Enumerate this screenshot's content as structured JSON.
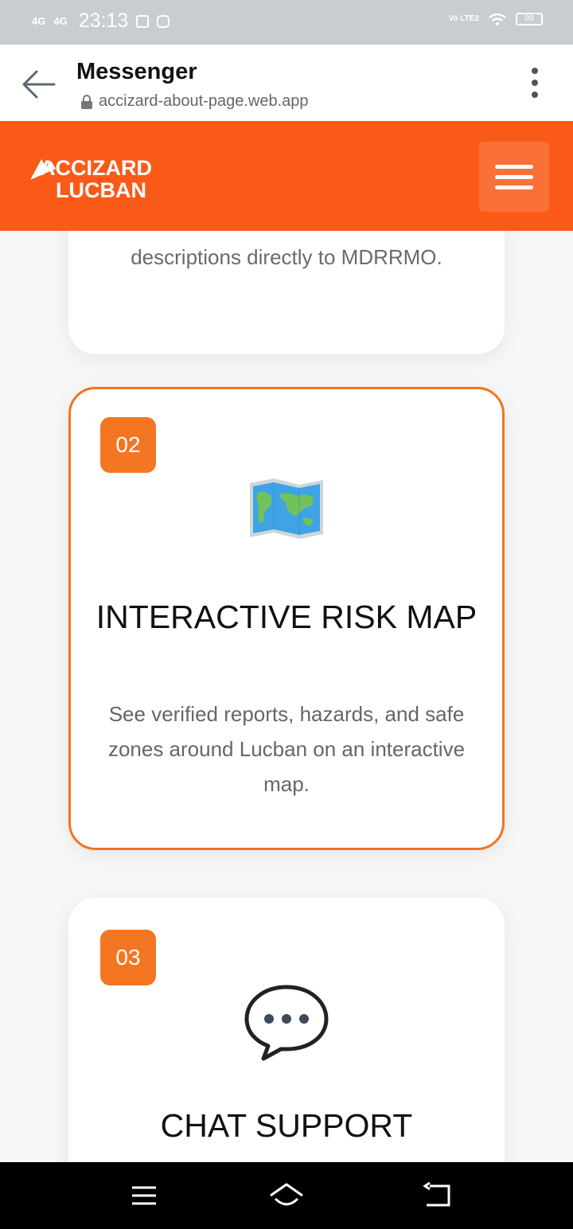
{
  "status_bar": {
    "network1": "4G",
    "network2": "4G",
    "time": "23:13",
    "volte": "Vo LTE2",
    "battery": "89"
  },
  "browser": {
    "title": "Messenger",
    "url": "accizard-about-page.web.app"
  },
  "header": {
    "logo_line1": "ACCIZARD",
    "logo_line2": "LUCBAN",
    "brand_color": "#fa5a17"
  },
  "features": [
    {
      "description_tail": "descriptions directly to MDRRMO."
    },
    {
      "number": "02",
      "icon": "world-map-icon",
      "title": "INTERACTIVE RISK MAP",
      "description": "See verified reports, hazards, and safe zones around Lucban on an interactive map."
    },
    {
      "number": "03",
      "icon": "speech-balloon-icon",
      "title": "CHAT SUPPORT"
    }
  ],
  "nav_bar": {
    "icons": [
      "menu-icon",
      "home-icon",
      "back-icon"
    ]
  }
}
